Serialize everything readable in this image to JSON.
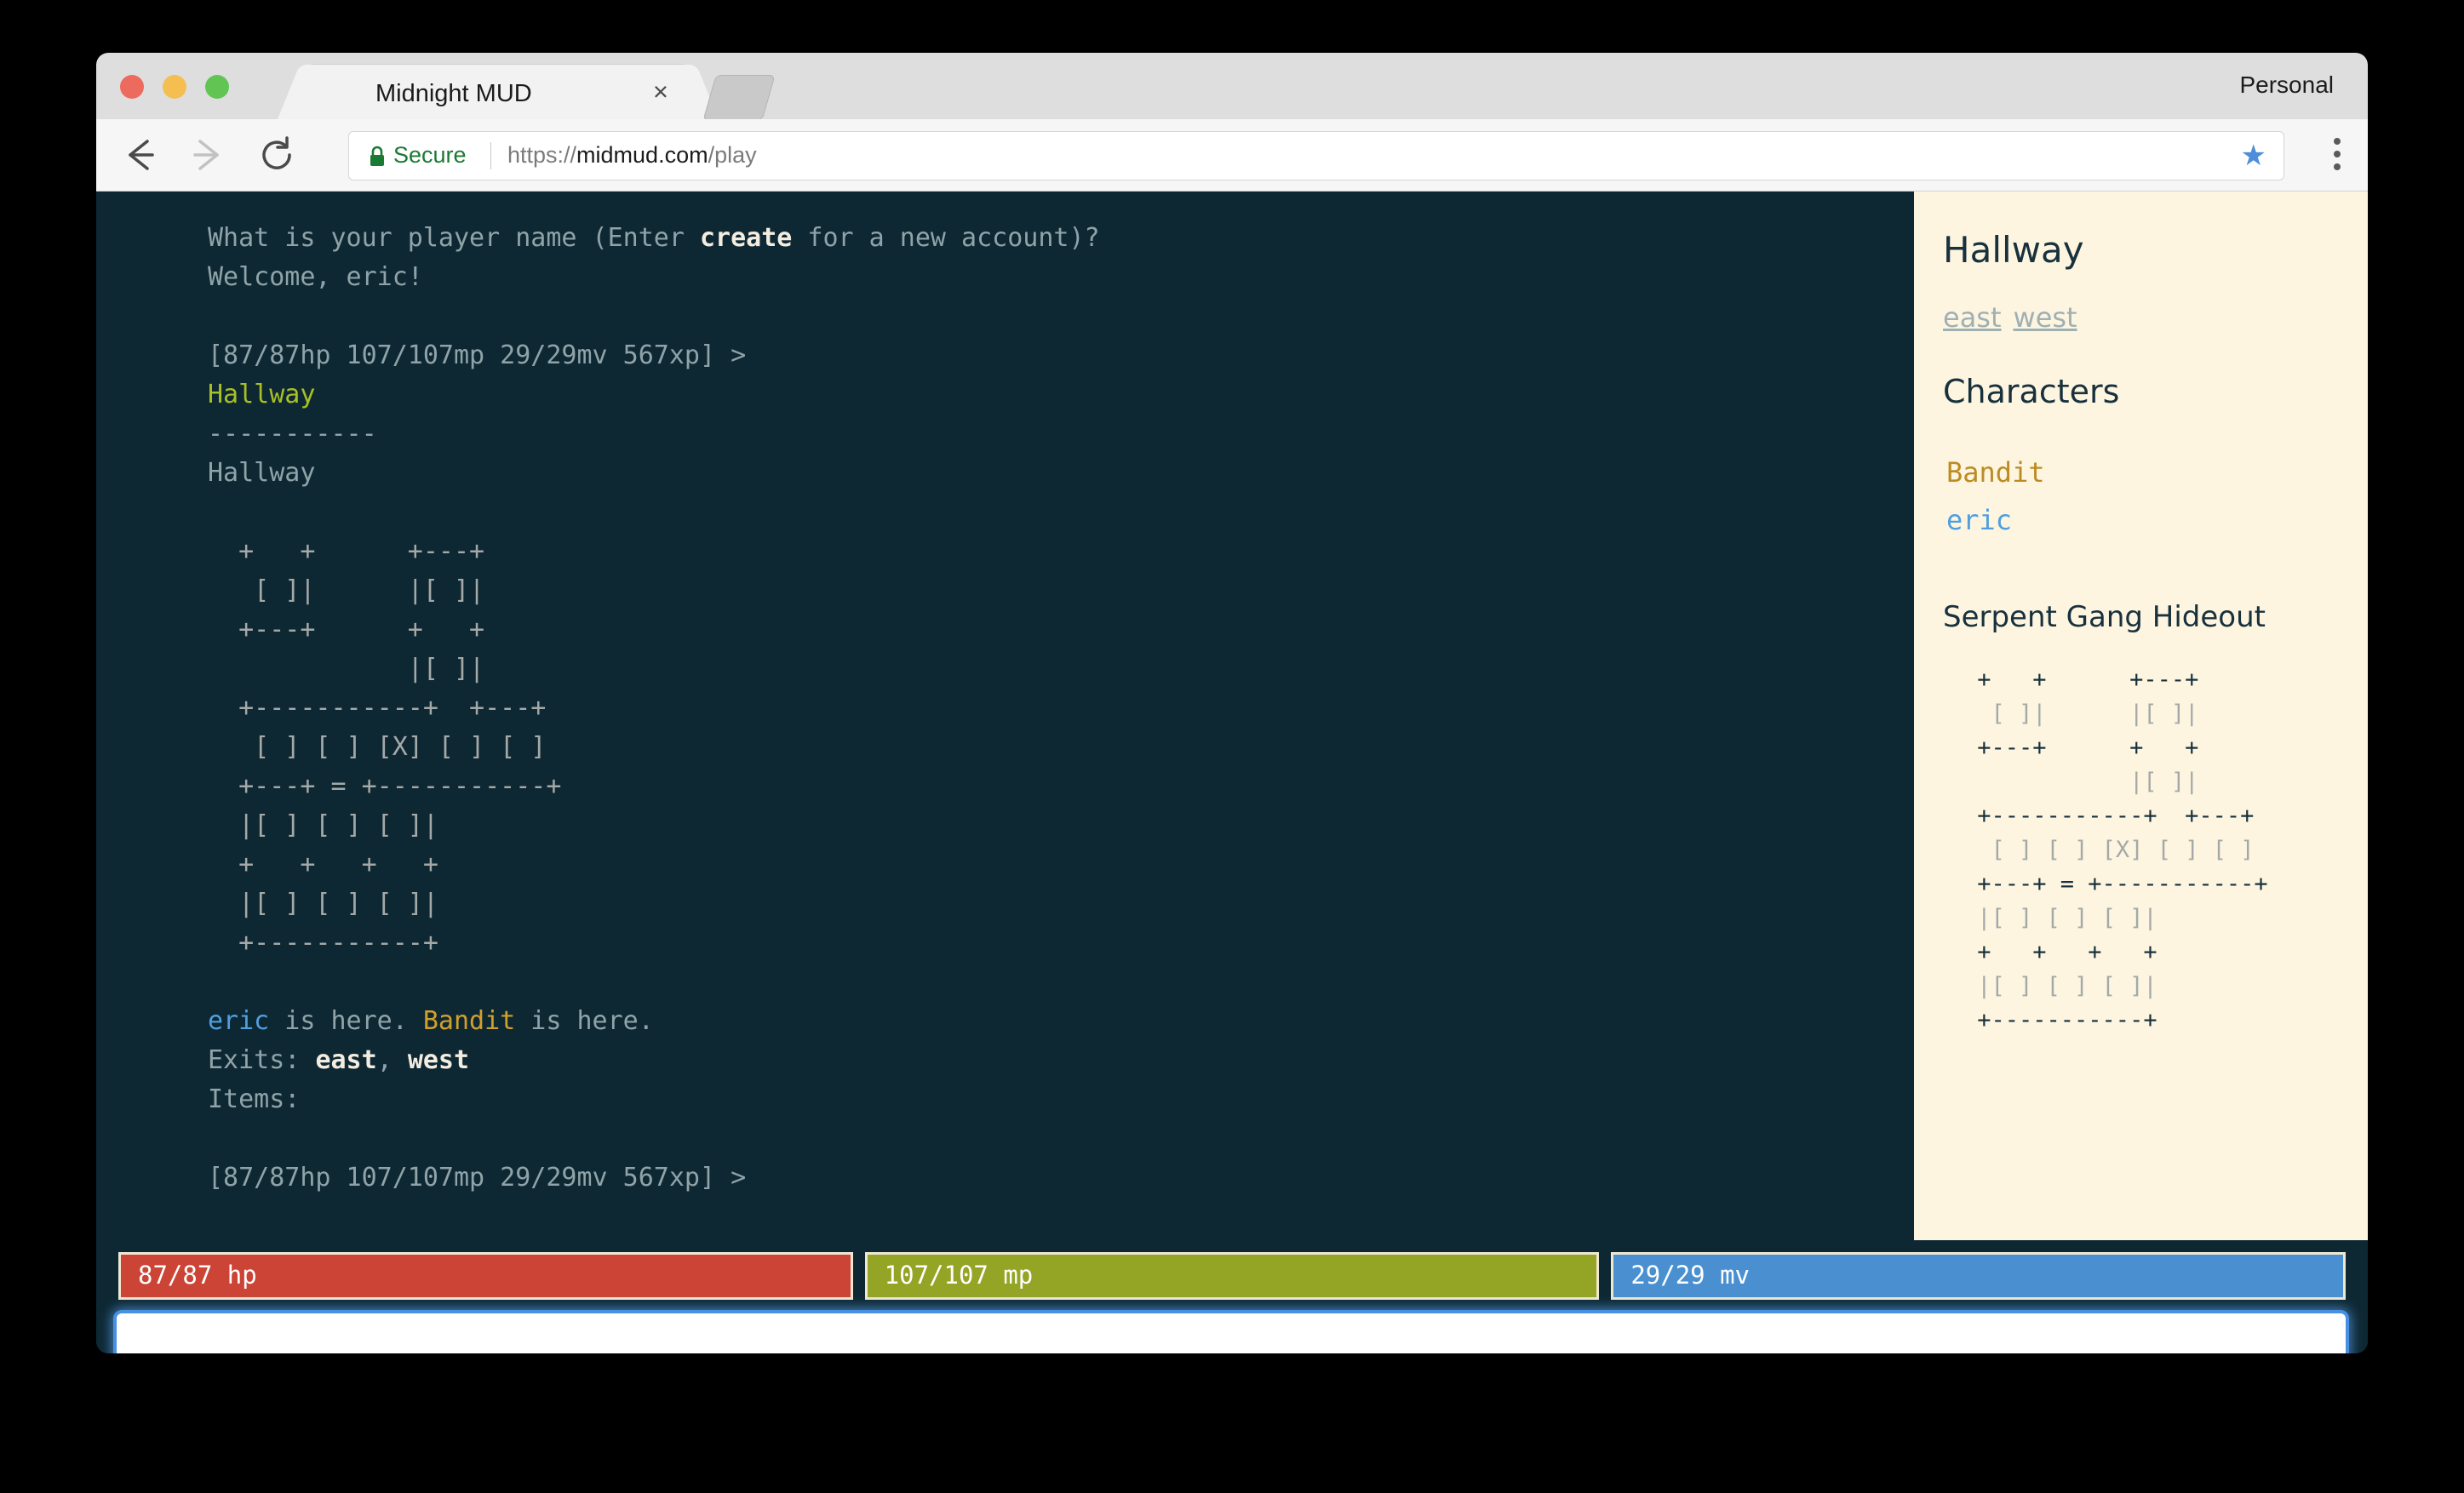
{
  "browser": {
    "profile_label": "Personal",
    "tab_title": "Midnight MUD",
    "tab_close_glyph": "×",
    "secure_label": "Secure",
    "url_scheme": "https://",
    "url_host": "midmud.com",
    "url_path": "/play",
    "bookmark_glyph": "★"
  },
  "terminal": {
    "lines": [
      {
        "segments": [
          {
            "text": "What is your player name (Enter ",
            "style": "dim"
          },
          {
            "text": "create",
            "style": "bold"
          },
          {
            "text": " for a new account)?",
            "style": "dim"
          }
        ]
      },
      {
        "segments": [
          {
            "text": "Welcome, eric!",
            "style": "dim"
          }
        ]
      },
      {
        "segments": [
          {
            "text": "",
            "style": "dim"
          }
        ]
      },
      {
        "segments": [
          {
            "text": "[87/87hp 107/107mp 29/29mv 567xp] >",
            "style": "dim"
          }
        ]
      },
      {
        "segments": [
          {
            "text": "Hallway",
            "style": "room"
          }
        ]
      },
      {
        "segments": [
          {
            "text": "-----------",
            "style": "dim"
          }
        ]
      },
      {
        "segments": [
          {
            "text": "Hallway",
            "style": "dim"
          }
        ]
      },
      {
        "segments": [
          {
            "text": "",
            "style": "dim"
          }
        ]
      },
      {
        "segments": [
          {
            "text": "  +   +      +---+",
            "style": "map"
          }
        ]
      },
      {
        "segments": [
          {
            "text": "   [ ]|      |[ ]|",
            "style": "map"
          }
        ]
      },
      {
        "segments": [
          {
            "text": "  +---+      +   +",
            "style": "map"
          }
        ]
      },
      {
        "segments": [
          {
            "text": "             |[ ]|",
            "style": "map"
          }
        ]
      },
      {
        "segments": [
          {
            "text": "  +-----------+  +---+",
            "style": "map"
          }
        ]
      },
      {
        "segments": [
          {
            "text": "   [ ] [ ] [X] [ ] [ ]",
            "style": "map"
          }
        ]
      },
      {
        "segments": [
          {
            "text": "  +---+ = +-----------+",
            "style": "map"
          }
        ]
      },
      {
        "segments": [
          {
            "text": "  |[ ] [ ] [ ]|",
            "style": "map"
          }
        ]
      },
      {
        "segments": [
          {
            "text": "  +   +   +   +",
            "style": "map"
          }
        ]
      },
      {
        "segments": [
          {
            "text": "  |[ ] [ ] [ ]|",
            "style": "map"
          }
        ]
      },
      {
        "segments": [
          {
            "text": "  +-----------+",
            "style": "map"
          }
        ]
      },
      {
        "segments": [
          {
            "text": "",
            "style": "dim"
          }
        ]
      },
      {
        "segments": [
          {
            "text": "eric",
            "style": "player"
          },
          {
            "text": " is here. ",
            "style": "dim"
          },
          {
            "text": "Bandit",
            "style": "mob"
          },
          {
            "text": " is here.",
            "style": "dim"
          }
        ]
      },
      {
        "segments": [
          {
            "text": "Exits: ",
            "style": "dim"
          },
          {
            "text": "east",
            "style": "bold"
          },
          {
            "text": ", ",
            "style": "dim"
          },
          {
            "text": "west",
            "style": "bold"
          }
        ]
      },
      {
        "segments": [
          {
            "text": "Items:",
            "style": "dim"
          }
        ]
      },
      {
        "segments": [
          {
            "text": "",
            "style": "dim"
          }
        ]
      },
      {
        "segments": [
          {
            "text": "[87/87hp 107/107mp 29/29mv 567xp] >",
            "style": "dim"
          }
        ]
      }
    ]
  },
  "sidebar": {
    "room_title": "Hallway",
    "exits": [
      "east",
      "west"
    ],
    "characters_heading": "Characters",
    "characters": [
      {
        "name": "Bandit",
        "kind": "mob"
      },
      {
        "name": "eric",
        "kind": "player"
      }
    ],
    "area_title": "Serpent Gang Hideout",
    "map_lines": [
      " +   +      +---+",
      "  [ ]|      |[ ]|",
      " +---+      +   +",
      "            |[ ]|",
      " +-----------+  +---+",
      "  [ ] [ ] [X] [ ] [ ]",
      " +---+ = +-----------+",
      " |[ ] [ ] [ ]|",
      " +   +   +   +",
      " |[ ] [ ] [ ]|",
      " +-----------+"
    ]
  },
  "status": {
    "hp_label": "87/87 hp",
    "mp_label": "107/107 mp",
    "mv_label": "29/29 mv",
    "hp_color": "#cc4436",
    "mp_color": "#94a526",
    "mv_color": "#4a90d0"
  },
  "command": {
    "value": "",
    "placeholder": ""
  }
}
